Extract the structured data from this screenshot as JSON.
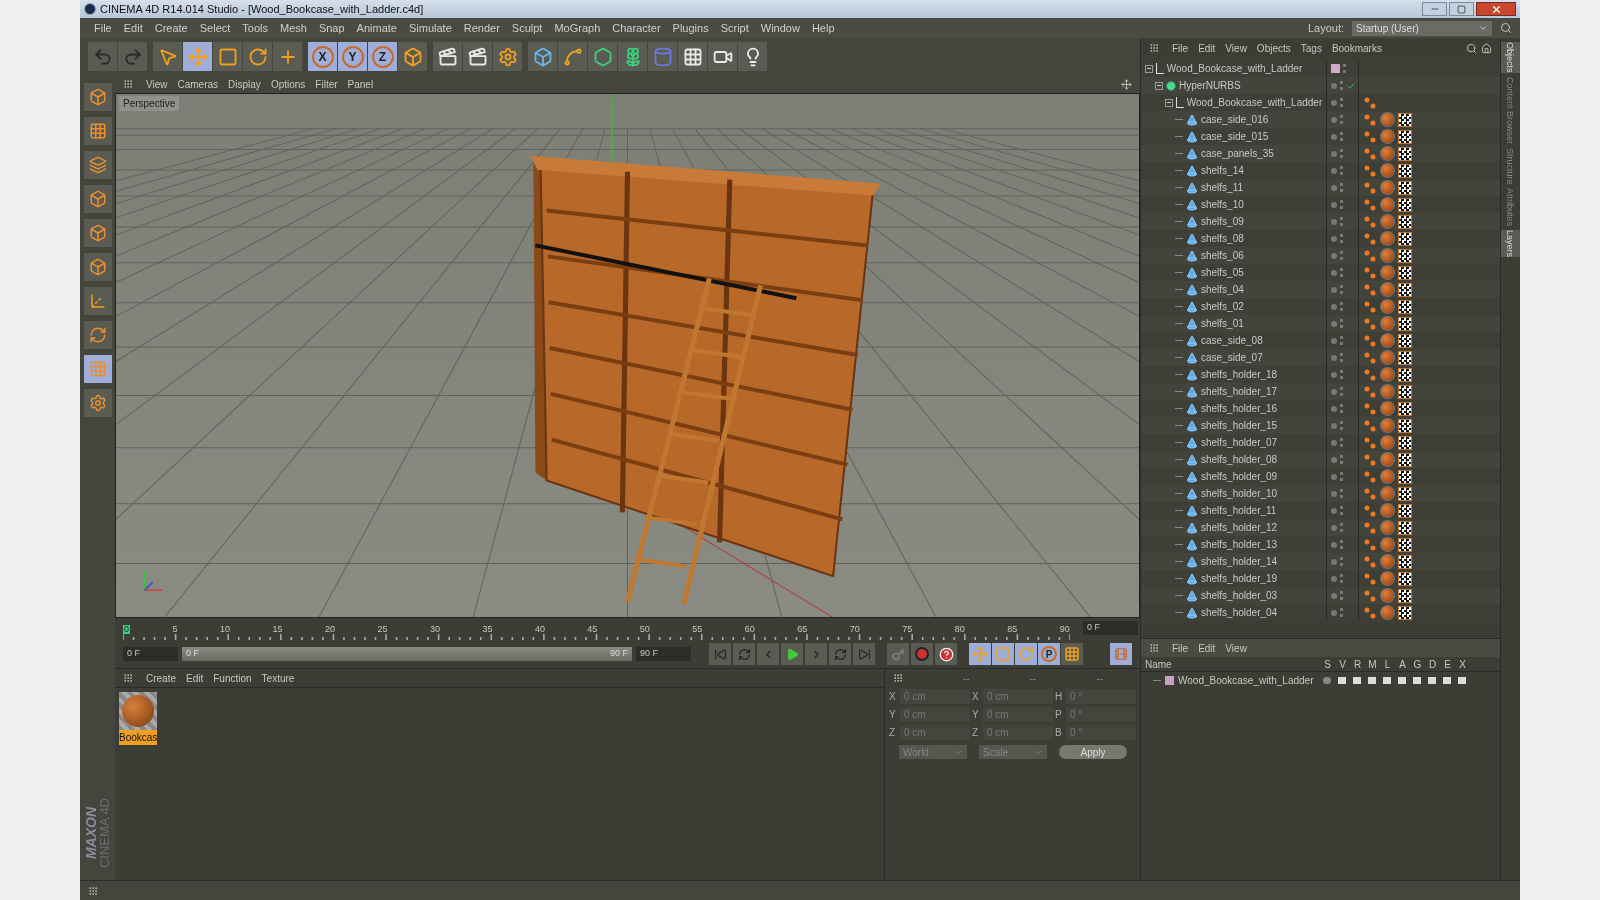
{
  "window": {
    "title": "CINEMA 4D R14.014 Studio - [Wood_Bookcase_with_Ladder.c4d]"
  },
  "menu": [
    "File",
    "Edit",
    "Create",
    "Select",
    "Tools",
    "Mesh",
    "Snap",
    "Animate",
    "Simulate",
    "Render",
    "Sculpt",
    "MoGraph",
    "Character",
    "Plugins",
    "Script",
    "Window",
    "Help"
  ],
  "layout": {
    "label": "Layout:",
    "value": "Startup (User)"
  },
  "toolbar": [
    [
      {
        "kind": "undo",
        "active": false
      },
      {
        "kind": "redo",
        "active": false
      }
    ],
    [
      {
        "kind": "select",
        "active": false
      },
      {
        "kind": "move",
        "active": true
      },
      {
        "kind": "scale",
        "active": false
      },
      {
        "kind": "rotate",
        "active": false
      },
      {
        "kind": "add",
        "active": false
      }
    ],
    [
      {
        "kind": "axis",
        "label": "X",
        "active": true
      },
      {
        "kind": "axis",
        "label": "Y",
        "active": true
      },
      {
        "kind": "axis",
        "label": "Z",
        "active": true
      },
      {
        "kind": "coord",
        "active": false
      }
    ],
    [
      {
        "kind": "renderview",
        "active": false
      },
      {
        "kind": "render",
        "active": false
      },
      {
        "kind": "rendersettings",
        "active": false
      }
    ],
    [
      {
        "kind": "cube",
        "active": false
      },
      {
        "kind": "spline",
        "active": false
      },
      {
        "kind": "nurbs",
        "active": false
      },
      {
        "kind": "array",
        "active": false
      },
      {
        "kind": "deformer",
        "active": false
      },
      {
        "kind": "floor",
        "active": false
      },
      {
        "kind": "camera",
        "active": false
      },
      {
        "kind": "light",
        "active": false
      }
    ]
  ],
  "viewport": {
    "menu": [
      "View",
      "Cameras",
      "Display",
      "Options",
      "Filter",
      "Panel"
    ],
    "camera": "Perspective"
  },
  "timeline": {
    "ticks": [
      "0",
      "5",
      "10",
      "15",
      "20",
      "25",
      "30",
      "35",
      "40",
      "45",
      "50",
      "55",
      "60",
      "65",
      "70",
      "75",
      "80",
      "85",
      "90"
    ],
    "current_frame": "0 F",
    "start": "0 F",
    "range_start": "0 F",
    "range_end": "90 F",
    "end": "90 F",
    "level": 1,
    "key_buttons": [
      {
        "kind": "move",
        "active": true
      },
      {
        "kind": "scale",
        "active": true
      },
      {
        "kind": "rotate",
        "active": true
      },
      {
        "kind": "param",
        "label": "P",
        "active": true
      },
      {
        "kind": "points",
        "active": false
      }
    ]
  },
  "materials": {
    "menu": [
      "Create",
      "Edit",
      "Function",
      "Texture"
    ],
    "items": [
      {
        "name": "Bookcas",
        "selected": true
      }
    ]
  },
  "coordinates": {
    "headers": [
      "--",
      "--",
      "--"
    ],
    "rows": [
      {
        "axes": [
          "X",
          "X",
          "H"
        ],
        "values": [
          "0 cm",
          "0 cm",
          "0 °"
        ]
      },
      {
        "axes": [
          "Y",
          "Y",
          "P"
        ],
        "values": [
          "0 cm",
          "0 cm",
          "0 °"
        ]
      },
      {
        "axes": [
          "Z",
          "Z",
          "B"
        ],
        "values": [
          "0 cm",
          "0 cm",
          "0 °"
        ]
      }
    ],
    "dropdowns": [
      "World",
      "Scale"
    ],
    "apply": "Apply"
  },
  "objects": {
    "menu": [
      "File",
      "Edit",
      "View",
      "Objects",
      "Tags",
      "Bookmarks"
    ],
    "tree": [
      {
        "name": "Wood_Bookcase_with_Ladder",
        "kind": "null",
        "color": "#d4a8cc",
        "expanded": true,
        "children": [
          {
            "name": "HyperNURBS",
            "kind": "nurbs",
            "enabled": true,
            "expanded": true,
            "children": [
              {
                "name": "Wood_Bookcase_with_Ladder",
                "kind": "null",
                "expanded": true,
                "tags": [
                  {
                    "kind": "phong"
                  }
                ],
                "children": [
                  {
                    "name": "case_side_016",
                    "kind": "polygon",
                    "tags": [
                      {
                        "kind": "phong"
                      },
                      {
                        "kind": "material"
                      },
                      {
                        "kind": "texture"
                      }
                    ]
                  },
                  {
                    "name": "case_side_015",
                    "kind": "polygon",
                    "tags": [
                      {
                        "kind": "phong"
                      },
                      {
                        "kind": "material"
                      },
                      {
                        "kind": "texture"
                      }
                    ]
                  },
                  {
                    "name": "case_panels_35",
                    "kind": "polygon",
                    "tags": [
                      {
                        "kind": "phong"
                      },
                      {
                        "kind": "material"
                      },
                      {
                        "kind": "texture"
                      }
                    ]
                  },
                  {
                    "name": "shelfs_14",
                    "kind": "polygon",
                    "tags": [
                      {
                        "kind": "phong"
                      },
                      {
                        "kind": "material"
                      },
                      {
                        "kind": "texture"
                      }
                    ]
                  },
                  {
                    "name": "shelfs_11",
                    "kind": "polygon",
                    "tags": [
                      {
                        "kind": "phong"
                      },
                      {
                        "kind": "material"
                      },
                      {
                        "kind": "texture"
                      }
                    ]
                  },
                  {
                    "name": "shelfs_10",
                    "kind": "polygon",
                    "tags": [
                      {
                        "kind": "phong"
                      },
                      {
                        "kind": "material"
                      },
                      {
                        "kind": "texture"
                      }
                    ]
                  },
                  {
                    "name": "shelfs_09",
                    "kind": "polygon",
                    "tags": [
                      {
                        "kind": "phong"
                      },
                      {
                        "kind": "material"
                      },
                      {
                        "kind": "texture"
                      }
                    ]
                  },
                  {
                    "name": "shelfs_08",
                    "kind": "polygon",
                    "tags": [
                      {
                        "kind": "phong"
                      },
                      {
                        "kind": "material"
                      },
                      {
                        "kind": "texture"
                      }
                    ]
                  },
                  {
                    "name": "shelfs_06",
                    "kind": "polygon",
                    "tags": [
                      {
                        "kind": "phong"
                      },
                      {
                        "kind": "material"
                      },
                      {
                        "kind": "texture"
                      }
                    ]
                  },
                  {
                    "name": "shelfs_05",
                    "kind": "polygon",
                    "tags": [
                      {
                        "kind": "phong"
                      },
                      {
                        "kind": "material"
                      },
                      {
                        "kind": "texture"
                      }
                    ]
                  },
                  {
                    "name": "shelfs_04",
                    "kind": "polygon",
                    "tags": [
                      {
                        "kind": "phong"
                      },
                      {
                        "kind": "material"
                      },
                      {
                        "kind": "texture"
                      }
                    ]
                  },
                  {
                    "name": "shelfs_02",
                    "kind": "polygon",
                    "tags": [
                      {
                        "kind": "phong"
                      },
                      {
                        "kind": "material"
                      },
                      {
                        "kind": "texture"
                      }
                    ]
                  },
                  {
                    "name": "shelfs_01",
                    "kind": "polygon",
                    "tags": [
                      {
                        "kind": "phong"
                      },
                      {
                        "kind": "material"
                      },
                      {
                        "kind": "texture"
                      }
                    ]
                  },
                  {
                    "name": "case_side_08",
                    "kind": "polygon",
                    "tags": [
                      {
                        "kind": "phong"
                      },
                      {
                        "kind": "material"
                      },
                      {
                        "kind": "texture"
                      }
                    ]
                  },
                  {
                    "name": "case_side_07",
                    "kind": "polygon",
                    "tags": [
                      {
                        "kind": "phong"
                      },
                      {
                        "kind": "material"
                      },
                      {
                        "kind": "texture"
                      }
                    ]
                  },
                  {
                    "name": "shelfs_holder_18",
                    "kind": "polygon",
                    "tags": [
                      {
                        "kind": "phong"
                      },
                      {
                        "kind": "material"
                      },
                      {
                        "kind": "texture"
                      }
                    ]
                  },
                  {
                    "name": "shelfs_holder_17",
                    "kind": "polygon",
                    "tags": [
                      {
                        "kind": "phong"
                      },
                      {
                        "kind": "material"
                      },
                      {
                        "kind": "texture"
                      }
                    ]
                  },
                  {
                    "name": "shelfs_holder_16",
                    "kind": "polygon",
                    "tags": [
                      {
                        "kind": "phong"
                      },
                      {
                        "kind": "material"
                      },
                      {
                        "kind": "texture"
                      }
                    ]
                  },
                  {
                    "name": "shelfs_holder_15",
                    "kind": "polygon",
                    "tags": [
                      {
                        "kind": "phong"
                      },
                      {
                        "kind": "material"
                      },
                      {
                        "kind": "texture"
                      }
                    ]
                  },
                  {
                    "name": "shelfs_holder_07",
                    "kind": "polygon",
                    "tags": [
                      {
                        "kind": "phong"
                      },
                      {
                        "kind": "material"
                      },
                      {
                        "kind": "texture"
                      }
                    ]
                  },
                  {
                    "name": "shelfs_holder_08",
                    "kind": "polygon",
                    "tags": [
                      {
                        "kind": "phong"
                      },
                      {
                        "kind": "material"
                      },
                      {
                        "kind": "texture"
                      }
                    ]
                  },
                  {
                    "name": "shelfs_holder_09",
                    "kind": "polygon",
                    "tags": [
                      {
                        "kind": "phong"
                      },
                      {
                        "kind": "material"
                      },
                      {
                        "kind": "texture"
                      }
                    ]
                  },
                  {
                    "name": "shelfs_holder_10",
                    "kind": "polygon",
                    "tags": [
                      {
                        "kind": "phong"
                      },
                      {
                        "kind": "material"
                      },
                      {
                        "kind": "texture"
                      }
                    ]
                  },
                  {
                    "name": "shelfs_holder_11",
                    "kind": "polygon",
                    "tags": [
                      {
                        "kind": "phong"
                      },
                      {
                        "kind": "material"
                      },
                      {
                        "kind": "texture"
                      }
                    ]
                  },
                  {
                    "name": "shelfs_holder_12",
                    "kind": "polygon",
                    "tags": [
                      {
                        "kind": "phong"
                      },
                      {
                        "kind": "material"
                      },
                      {
                        "kind": "texture"
                      }
                    ]
                  },
                  {
                    "name": "shelfs_holder_13",
                    "kind": "polygon",
                    "tags": [
                      {
                        "kind": "phong"
                      },
                      {
                        "kind": "material"
                      },
                      {
                        "kind": "texture"
                      }
                    ]
                  },
                  {
                    "name": "shelfs_holder_14",
                    "kind": "polygon",
                    "tags": [
                      {
                        "kind": "phong"
                      },
                      {
                        "kind": "material"
                      },
                      {
                        "kind": "texture"
                      }
                    ]
                  },
                  {
                    "name": "shelfs_holder_19",
                    "kind": "polygon",
                    "tags": [
                      {
                        "kind": "phong"
                      },
                      {
                        "kind": "material"
                      },
                      {
                        "kind": "texture"
                      }
                    ]
                  },
                  {
                    "name": "shelfs_holder_03",
                    "kind": "polygon",
                    "tags": [
                      {
                        "kind": "phong"
                      },
                      {
                        "kind": "material"
                      },
                      {
                        "kind": "texture"
                      }
                    ]
                  },
                  {
                    "name": "shelfs_holder_04",
                    "kind": "polygon",
                    "tags": [
                      {
                        "kind": "phong"
                      },
                      {
                        "kind": "material"
                      },
                      {
                        "kind": "texture"
                      }
                    ]
                  }
                ]
              }
            ]
          }
        ]
      }
    ]
  },
  "layers": {
    "menu": [
      "File",
      "Edit",
      "View"
    ],
    "columns": [
      "Name",
      "S",
      "V",
      "R",
      "M",
      "L",
      "A",
      "G",
      "D",
      "E",
      "X"
    ],
    "rows": [
      {
        "name": "Wood_Bookcase_with_Ladder",
        "color": "#c8a0c4"
      }
    ]
  },
  "side_tabs": [
    {
      "label": "Objects",
      "selected": true
    },
    {
      "label": "Content Browser",
      "selected": false
    },
    {
      "label": "Structure",
      "selected": false
    },
    {
      "label": "Attributes",
      "selected": false
    },
    {
      "label": "Layers",
      "selected": true
    }
  ],
  "logo": {
    "brand": "MAXON",
    "product": "CINEMA 4D"
  }
}
